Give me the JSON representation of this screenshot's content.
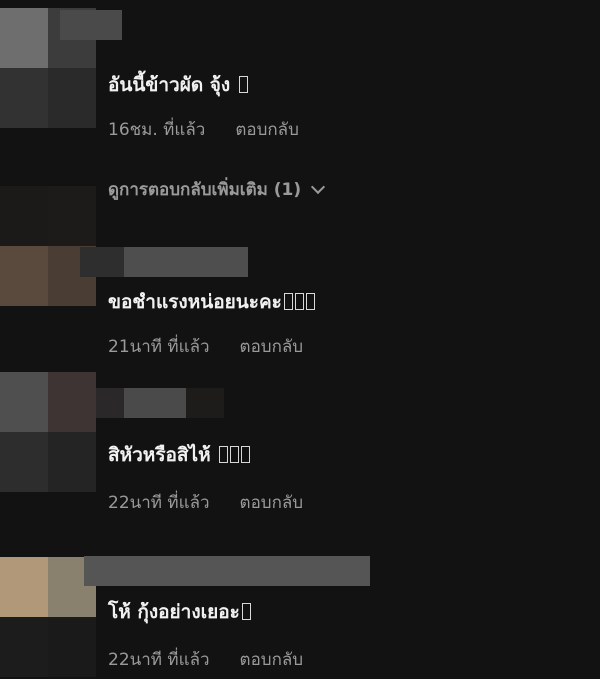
{
  "comments": [
    {
      "text": "อันนี้ข้าวผัด จุ้ง",
      "emoji_boxes": 1,
      "time": "16ชม. ที่แล้ว",
      "reply_label": "ตอบกลับ"
    },
    {
      "text": "ขอชำแรงหน่อยนะคะ",
      "emoji_boxes": 3,
      "time": "21นาที ที่แล้ว",
      "reply_label": "ตอบกลับ"
    },
    {
      "text": "สิหัวหรือสิไห้",
      "emoji_boxes": 3,
      "time": "22นาที ที่แล้ว",
      "reply_label": "ตอบกลับ"
    },
    {
      "text": "โห้ กุ้งอย่างเยอะ",
      "emoji_boxes": 1,
      "time": "22นาที ที่แล้ว",
      "reply_label": "ตอบกลับ"
    }
  ],
  "more_replies": {
    "label": "ดูการตอบกลับเพิ่มเติม (1)",
    "icon": "chevron-down-icon"
  },
  "colors": {
    "background": "#121212",
    "text": "#f1f1f1",
    "meta": "#9a9a9a"
  }
}
